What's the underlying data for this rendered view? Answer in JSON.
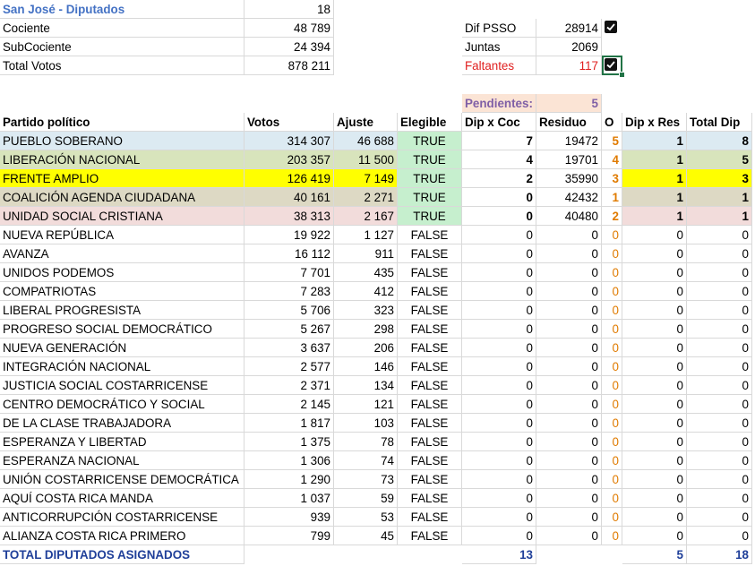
{
  "header": {
    "title": "San José - Diputados",
    "seats": "18",
    "cociente_label": "Cociente",
    "cociente_value": "48 789",
    "subcociente_label": "SubCociente",
    "subcociente_value": "24 394",
    "total_votos_label": "Total Votos",
    "total_votos_value": "878 211"
  },
  "side": {
    "dif_psso_label": "Dif PSSO",
    "dif_psso_value": "28914",
    "juntas_label": "Juntas",
    "juntas_value": "2069",
    "faltantes_label": "Faltantes",
    "faltantes_value": "117",
    "pendientes_label": "Pendientes:",
    "pendientes_value": "5"
  },
  "columns": [
    "Partido político",
    "Votos",
    "Ajuste",
    "Elegible",
    "Dip x Coc",
    "Residuo",
    "O",
    "Dip x Res",
    "Total Dip"
  ],
  "colors": {
    "pueblo": "#dceaf2",
    "liberacion": "#d8e4bc",
    "frente": "#ffff00",
    "coalicion": "#ddd9c4",
    "unidad": "#f2dcdb",
    "true_bg": "#c6efce"
  },
  "rows": [
    {
      "party": "PUEBLO SOBERANO",
      "votos": "314 307",
      "ajuste": "46 688",
      "elegible": "TRUE",
      "dipcoc": "7",
      "residuo": "19472",
      "o": "5",
      "dipres": "1",
      "total": "8"
    },
    {
      "party": "LIBERACIÓN NACIONAL",
      "votos": "203 357",
      "ajuste": "11 500",
      "elegible": "TRUE",
      "dipcoc": "4",
      "residuo": "19701",
      "o": "4",
      "dipres": "1",
      "total": "5"
    },
    {
      "party": "FRENTE AMPLIO",
      "votos": "126 419",
      "ajuste": "7 149",
      "elegible": "TRUE",
      "dipcoc": "2",
      "residuo": "35990",
      "o": "3",
      "dipres": "1",
      "total": "3"
    },
    {
      "party": "COALICIÓN AGENDA CIUDADANA",
      "votos": "40 161",
      "ajuste": "2 271",
      "elegible": "TRUE",
      "dipcoc": "0",
      "residuo": "42432",
      "o": "1",
      "dipres": "1",
      "total": "1"
    },
    {
      "party": "UNIDAD SOCIAL CRISTIANA",
      "votos": "38 313",
      "ajuste": "2 167",
      "elegible": "TRUE",
      "dipcoc": "0",
      "residuo": "40480",
      "o": "2",
      "dipres": "1",
      "total": "1"
    },
    {
      "party": "NUEVA REPÚBLICA",
      "votos": "19 922",
      "ajuste": "1 127",
      "elegible": "FALSE",
      "dipcoc": "0",
      "residuo": "0",
      "o": "0",
      "dipres": "0",
      "total": "0"
    },
    {
      "party": "AVANZA",
      "votos": "16 112",
      "ajuste": "911",
      "elegible": "FALSE",
      "dipcoc": "0",
      "residuo": "0",
      "o": "0",
      "dipres": "0",
      "total": "0"
    },
    {
      "party": "UNIDOS PODEMOS",
      "votos": "7 701",
      "ajuste": "435",
      "elegible": "FALSE",
      "dipcoc": "0",
      "residuo": "0",
      "o": "0",
      "dipres": "0",
      "total": "0"
    },
    {
      "party": "COMPATRIOTAS",
      "votos": "7 283",
      "ajuste": "412",
      "elegible": "FALSE",
      "dipcoc": "0",
      "residuo": "0",
      "o": "0",
      "dipres": "0",
      "total": "0"
    },
    {
      "party": "LIBERAL PROGRESISTA",
      "votos": "5 706",
      "ajuste": "323",
      "elegible": "FALSE",
      "dipcoc": "0",
      "residuo": "0",
      "o": "0",
      "dipres": "0",
      "total": "0"
    },
    {
      "party": "PROGRESO SOCIAL DEMOCRÁTICO",
      "votos": "5 267",
      "ajuste": "298",
      "elegible": "FALSE",
      "dipcoc": "0",
      "residuo": "0",
      "o": "0",
      "dipres": "0",
      "total": "0"
    },
    {
      "party": "NUEVA GENERACIÓN",
      "votos": "3 637",
      "ajuste": "206",
      "elegible": "FALSE",
      "dipcoc": "0",
      "residuo": "0",
      "o": "0",
      "dipres": "0",
      "total": "0"
    },
    {
      "party": "INTEGRACIÓN NACIONAL",
      "votos": "2 577",
      "ajuste": "146",
      "elegible": "FALSE",
      "dipcoc": "0",
      "residuo": "0",
      "o": "0",
      "dipres": "0",
      "total": "0"
    },
    {
      "party": "JUSTICIA SOCIAL COSTARRICENSE",
      "votos": "2 371",
      "ajuste": "134",
      "elegible": "FALSE",
      "dipcoc": "0",
      "residuo": "0",
      "o": "0",
      "dipres": "0",
      "total": "0"
    },
    {
      "party": "CENTRO DEMOCRÁTICO Y SOCIAL",
      "votos": "2 145",
      "ajuste": "121",
      "elegible": "FALSE",
      "dipcoc": "0",
      "residuo": "0",
      "o": "0",
      "dipres": "0",
      "total": "0"
    },
    {
      "party": "DE LA CLASE TRABAJADORA",
      "votos": "1 817",
      "ajuste": "103",
      "elegible": "FALSE",
      "dipcoc": "0",
      "residuo": "0",
      "o": "0",
      "dipres": "0",
      "total": "0"
    },
    {
      "party": "ESPERANZA Y LIBERTAD",
      "votos": "1 375",
      "ajuste": "78",
      "elegible": "FALSE",
      "dipcoc": "0",
      "residuo": "0",
      "o": "0",
      "dipres": "0",
      "total": "0"
    },
    {
      "party": "ESPERANZA NACIONAL",
      "votos": "1 306",
      "ajuste": "74",
      "elegible": "FALSE",
      "dipcoc": "0",
      "residuo": "0",
      "o": "0",
      "dipres": "0",
      "total": "0"
    },
    {
      "party": "UNIÓN COSTARRICENSE DEMOCRÁTICA",
      "votos": "1 290",
      "ajuste": "73",
      "elegible": "FALSE",
      "dipcoc": "0",
      "residuo": "0",
      "o": "0",
      "dipres": "0",
      "total": "0"
    },
    {
      "party": "AQUÍ COSTA RICA MANDA",
      "votos": "1 037",
      "ajuste": "59",
      "elegible": "FALSE",
      "dipcoc": "0",
      "residuo": "0",
      "o": "0",
      "dipres": "0",
      "total": "0"
    },
    {
      "party": "ANTICORRUPCIÓN COSTARRICENSE",
      "votos": "939",
      "ajuste": "53",
      "elegible": "FALSE",
      "dipcoc": "0",
      "residuo": "0",
      "o": "0",
      "dipres": "0",
      "total": "0"
    },
    {
      "party": "ALIANZA COSTA RICA PRIMERO",
      "votos": "799",
      "ajuste": "45",
      "elegible": "FALSE",
      "dipcoc": "0",
      "residuo": "0",
      "o": "0",
      "dipres": "0",
      "total": "0"
    }
  ],
  "totals": {
    "label": "TOTAL DIPUTADOS ASIGNADOS",
    "dipcoc": "13",
    "dipres": "5",
    "total": "18"
  }
}
